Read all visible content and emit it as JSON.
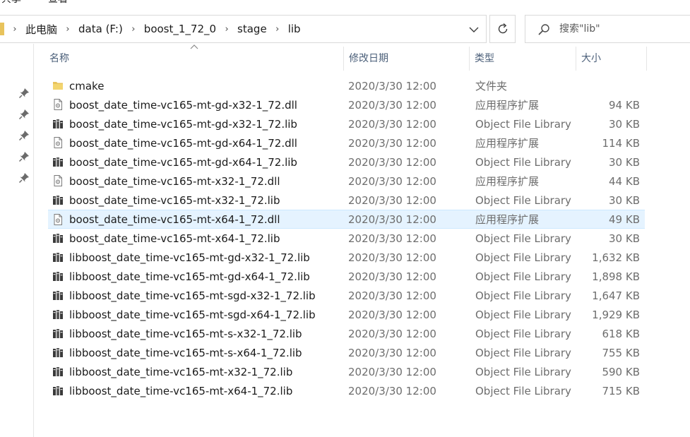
{
  "ribbon": {
    "tabs": [
      "共享",
      "查看"
    ]
  },
  "address": {
    "crumbs": [
      "此电脑",
      "data (F:)",
      "boost_1_72_0",
      "stage",
      "lib"
    ]
  },
  "search": {
    "placeholder": "搜索\"lib\""
  },
  "columns": {
    "name": "名称",
    "date": "修改日期",
    "type": "类型",
    "size": "大小"
  },
  "files": [
    {
      "name": "cmake",
      "date": "2020/3/30 12:00",
      "type": "文件夹",
      "size": "",
      "icon": "folder-icon"
    },
    {
      "name": "boost_date_time-vc165-mt-gd-x32-1_72.dll",
      "date": "2020/3/30 12:00",
      "type": "应用程序扩展",
      "size": "94 KB",
      "icon": "dll-file-icon"
    },
    {
      "name": "boost_date_time-vc165-mt-gd-x32-1_72.lib",
      "date": "2020/3/30 12:00",
      "type": "Object File Library",
      "size": "30 KB",
      "icon": "lib-file-icon"
    },
    {
      "name": "boost_date_time-vc165-mt-gd-x64-1_72.dll",
      "date": "2020/3/30 12:00",
      "type": "应用程序扩展",
      "size": "114 KB",
      "icon": "dll-file-icon"
    },
    {
      "name": "boost_date_time-vc165-mt-gd-x64-1_72.lib",
      "date": "2020/3/30 12:00",
      "type": "Object File Library",
      "size": "30 KB",
      "icon": "lib-file-icon"
    },
    {
      "name": "boost_date_time-vc165-mt-x32-1_72.dll",
      "date": "2020/3/30 12:00",
      "type": "应用程序扩展",
      "size": "44 KB",
      "icon": "dll-file-icon"
    },
    {
      "name": "boost_date_time-vc165-mt-x32-1_72.lib",
      "date": "2020/3/30 12:00",
      "type": "Object File Library",
      "size": "30 KB",
      "icon": "lib-file-icon"
    },
    {
      "name": "boost_date_time-vc165-mt-x64-1_72.dll",
      "date": "2020/3/30 12:00",
      "type": "应用程序扩展",
      "size": "49 KB",
      "icon": "dll-file-icon",
      "selected": true
    },
    {
      "name": "boost_date_time-vc165-mt-x64-1_72.lib",
      "date": "2020/3/30 12:00",
      "type": "Object File Library",
      "size": "30 KB",
      "icon": "lib-file-icon"
    },
    {
      "name": "libboost_date_time-vc165-mt-gd-x32-1_72.lib",
      "date": "2020/3/30 12:00",
      "type": "Object File Library",
      "size": "1,632 KB",
      "icon": "lib-file-icon"
    },
    {
      "name": "libboost_date_time-vc165-mt-gd-x64-1_72.lib",
      "date": "2020/3/30 12:00",
      "type": "Object File Library",
      "size": "1,898 KB",
      "icon": "lib-file-icon"
    },
    {
      "name": "libboost_date_time-vc165-mt-sgd-x32-1_72.lib",
      "date": "2020/3/30 12:00",
      "type": "Object File Library",
      "size": "1,647 KB",
      "icon": "lib-file-icon"
    },
    {
      "name": "libboost_date_time-vc165-mt-sgd-x64-1_72.lib",
      "date": "2020/3/30 12:00",
      "type": "Object File Library",
      "size": "1,929 KB",
      "icon": "lib-file-icon"
    },
    {
      "name": "libboost_date_time-vc165-mt-s-x32-1_72.lib",
      "date": "2020/3/30 12:00",
      "type": "Object File Library",
      "size": "618 KB",
      "icon": "lib-file-icon"
    },
    {
      "name": "libboost_date_time-vc165-mt-s-x64-1_72.lib",
      "date": "2020/3/30 12:00",
      "type": "Object File Library",
      "size": "755 KB",
      "icon": "lib-file-icon"
    },
    {
      "name": "libboost_date_time-vc165-mt-x32-1_72.lib",
      "date": "2020/3/30 12:00",
      "type": "Object File Library",
      "size": "590 KB",
      "icon": "lib-file-icon"
    },
    {
      "name": "libboost_date_time-vc165-mt-x64-1_72.lib",
      "date": "2020/3/30 12:00",
      "type": "Object File Library",
      "size": "715 KB",
      "icon": "lib-file-icon"
    }
  ],
  "colors": {
    "selection": "#e5f3ff",
    "header_text": "#4c607a",
    "folder": "#e8c35c"
  }
}
